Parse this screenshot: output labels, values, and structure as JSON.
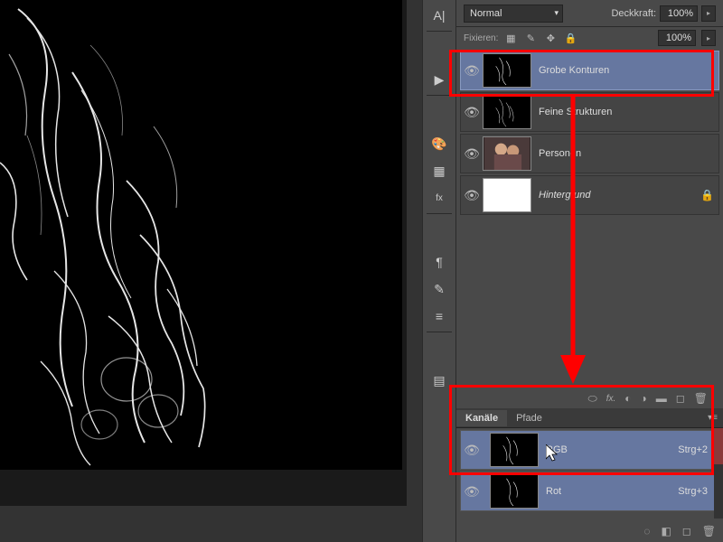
{
  "options_bar": {
    "blend_mode": "Normal",
    "opacity_label": "Deckkraft:",
    "opacity_value": "100%",
    "fill_value": "100%"
  },
  "lock_bar": {
    "label": "Fixieren:"
  },
  "layers": [
    {
      "name": "Grobe Konturen",
      "visible": true,
      "thumb": "edges",
      "selected": true
    },
    {
      "name": "Feine Strukturen",
      "visible": true,
      "thumb": "edges",
      "selected": false
    },
    {
      "name": "Personen",
      "visible": true,
      "thumb": "photo",
      "selected": false
    },
    {
      "name": "Hintergrund",
      "visible": true,
      "thumb": "white",
      "selected": false,
      "locked": true
    }
  ],
  "channels_panel": {
    "tab_channels": "Kanäle",
    "tab_paths": "Pfade",
    "channels": [
      {
        "name": "RGB",
        "shortcut": "Strg+2",
        "visible": true
      },
      {
        "name": "Rot",
        "shortcut": "Strg+3",
        "visible": true
      }
    ]
  },
  "annotations": {
    "color": "#ff0000"
  }
}
